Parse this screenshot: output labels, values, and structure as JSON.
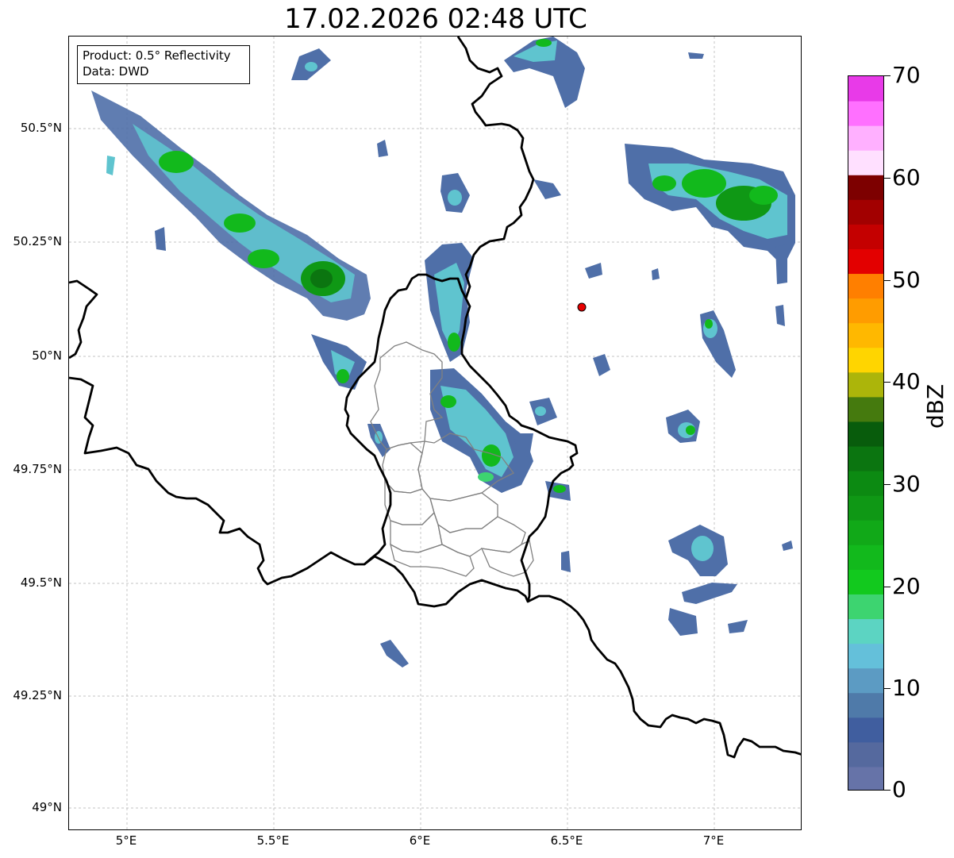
{
  "title": "17.02.2026 02:48 UTC",
  "info": {
    "product": "Product: 0.5° Reflectivity",
    "data": "Data: DWD"
  },
  "axes": {
    "lat_labels": [
      "50.5°N",
      "50.25°N",
      "50°N",
      "49.75°N",
      "49.5°N",
      "49.25°N",
      "49°N"
    ],
    "lon_labels": [
      "5°E",
      "5.5°E",
      "6°E",
      "6.5°E",
      "7°E"
    ]
  },
  "colorbar": {
    "unit": "dBZ",
    "tick_labels": [
      "70",
      "60",
      "50",
      "40",
      "30",
      "20",
      "10",
      "0"
    ],
    "min": 0,
    "max": 70,
    "colors": [
      "#6673a8",
      "#55699e",
      "#405e9f",
      "#4f7aa9",
      "#5c9bc3",
      "#64c0da",
      "#5cd4c2",
      "#3dd470",
      "#12c91e",
      "#12b91c",
      "#11a918",
      "#0f9815",
      "#0c8a12",
      "#0b7510",
      "#085c0c",
      "#457a0e",
      "#acb50a",
      "#ffd500",
      "#ffb800",
      "#ff9c00",
      "#ff7f00",
      "#e30000",
      "#c40000",
      "#a20000",
      "#7d0000",
      "#ffe0ff",
      "#ffb0ff",
      "#ff70ff",
      "#e83ae8"
    ]
  },
  "marker": {
    "label": "radar-site",
    "color": "#e80000"
  },
  "colors": {
    "country_border": "#000000",
    "admin_border": "#808080",
    "grid": "#b0b0b0",
    "echo_weak": "#4f6fa8",
    "echo_mid": "#5fc4cf",
    "echo_strong": "#12b91c"
  }
}
